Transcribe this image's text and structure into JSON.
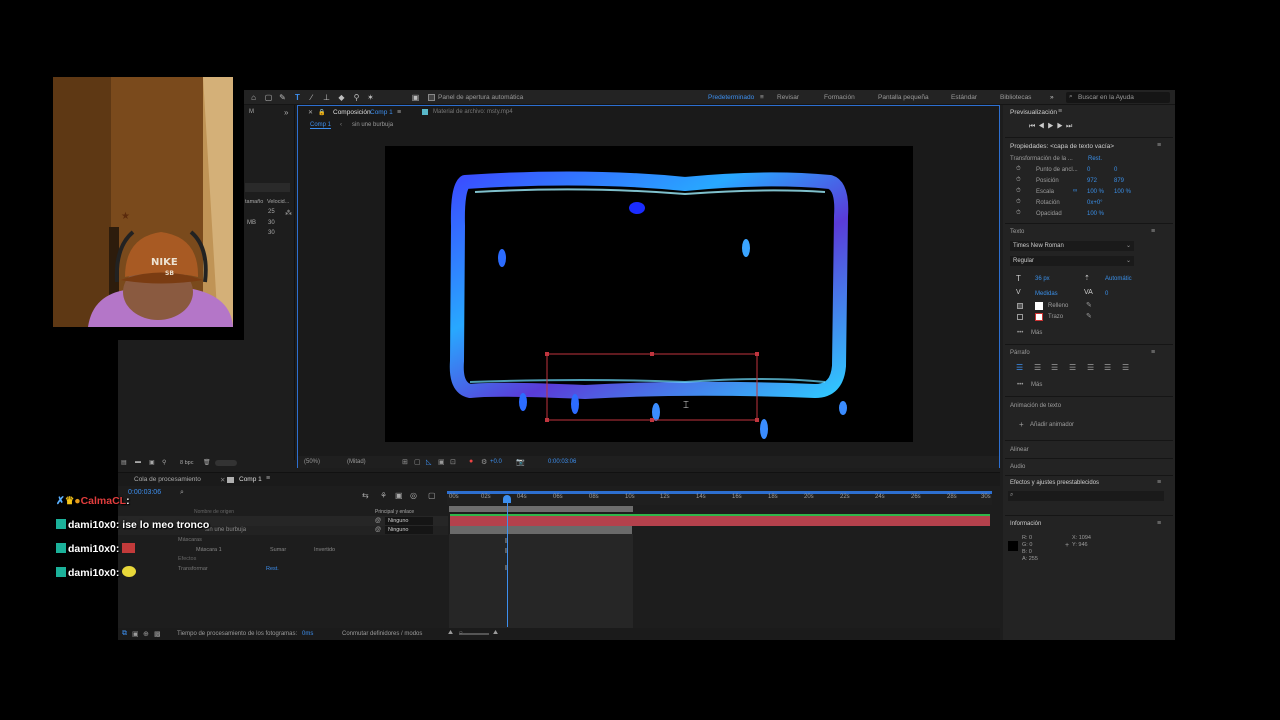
{
  "toolbar": {
    "auto_panel": "Panel de apertura automática",
    "workspaces": [
      "Predeterminado",
      "Revisar",
      "Formación",
      "Pantalla pequeña",
      "Estándar",
      "Bibliotecas"
    ],
    "search_placeholder": "Buscar en la Ayuda"
  },
  "comp_panel": {
    "tab_comp": "Composición",
    "tab_comp_name": "Comp 1",
    "tab_footage": "Material de archivo: msty.mp4",
    "breadcrumb_1": "Comp 1",
    "breadcrumb_2": "sin une burbuja",
    "zoom": "(50%)",
    "resolution": "(Mitad)",
    "offset": "+0.0",
    "timecode": "0:00:03:06"
  },
  "left_panel": {
    "col1": "tamaño",
    "col2": "Velocid...",
    "val1": "25",
    "val_mb": "MB",
    "val2": "30",
    "val3": "30",
    "bpc": "8 bpc"
  },
  "right_panel": {
    "preview_title": "Previsualización",
    "props_title": "Propiedades: <capa de texto vacía>",
    "transform_title": "Transformación de la ...",
    "reset": "Rest.",
    "anchor_label": "Punto de ancl...",
    "anchor_x": "0",
    "anchor_y": "0",
    "position_label": "Posición",
    "position_x": "972",
    "position_y": "879",
    "scale_label": "Escala",
    "scale_x": "100 %",
    "scale_y": "100 %",
    "rotation_label": "Rotación",
    "rotation_val": "0x+0°",
    "opacity_label": "Opacidad",
    "opacity_val": "100 %",
    "text_title": "Texto",
    "font": "Times New Roman",
    "style": "Regular",
    "size": "36 px",
    "leading": "Automátic",
    "kerning": "Medidas",
    "tracking": "0",
    "fill": "Relleno",
    "stroke": "Trazo",
    "more1": "Más",
    "paragraph_title": "Párrafo",
    "more2": "Más",
    "anim_title": "Animación de texto",
    "add_anim": "Añadir animador",
    "align_title": "Alinear",
    "audio_title": "Audio",
    "effects_title": "Efectos y ajustes preestablecidos",
    "info_title": "Información",
    "info_r": "R: 0",
    "info_g": "G: 0",
    "info_b": "B: 0",
    "info_a": "A: 255",
    "info_x": "X: 1094",
    "info_y": "Y: 946"
  },
  "timeline": {
    "tab_queue": "Cola de procesamiento",
    "tab_comp": "Comp 1",
    "current_time": "0:00:03:06",
    "col_source": "Nombre de origen",
    "col_parent": "Principal y enlace",
    "layer1_parent": "Ninguno",
    "layer2_name": "sin une burbuja",
    "layer2_parent": "Ninguno",
    "masks": "Máscaras",
    "mask1": "Máscara 1",
    "mask_mode": "Sumar",
    "mask_inverted": "Invertido",
    "effects": "Efectos",
    "transform": "Transformar",
    "transform_reset": "Rest.",
    "ticks": [
      "00s",
      "02s",
      "04s",
      "06s",
      "08s",
      "10s",
      "12s",
      "14s",
      "16s",
      "18s",
      "20s",
      "22s",
      "24s",
      "26s",
      "28s",
      "30s"
    ]
  },
  "status": {
    "frame_time": "Tiempo de procesamiento de los fotogramas:",
    "frame_time_val": "0ms",
    "toggle": "Conmutar definidores / modos"
  },
  "chat": [
    {
      "user": "CalmaCL",
      "message": ""
    },
    {
      "user": "dami10x0",
      "message": "ise lo meo tronco"
    },
    {
      "user": "dami10x0",
      "message": ""
    },
    {
      "user": "dami10x0",
      "message": ""
    }
  ]
}
